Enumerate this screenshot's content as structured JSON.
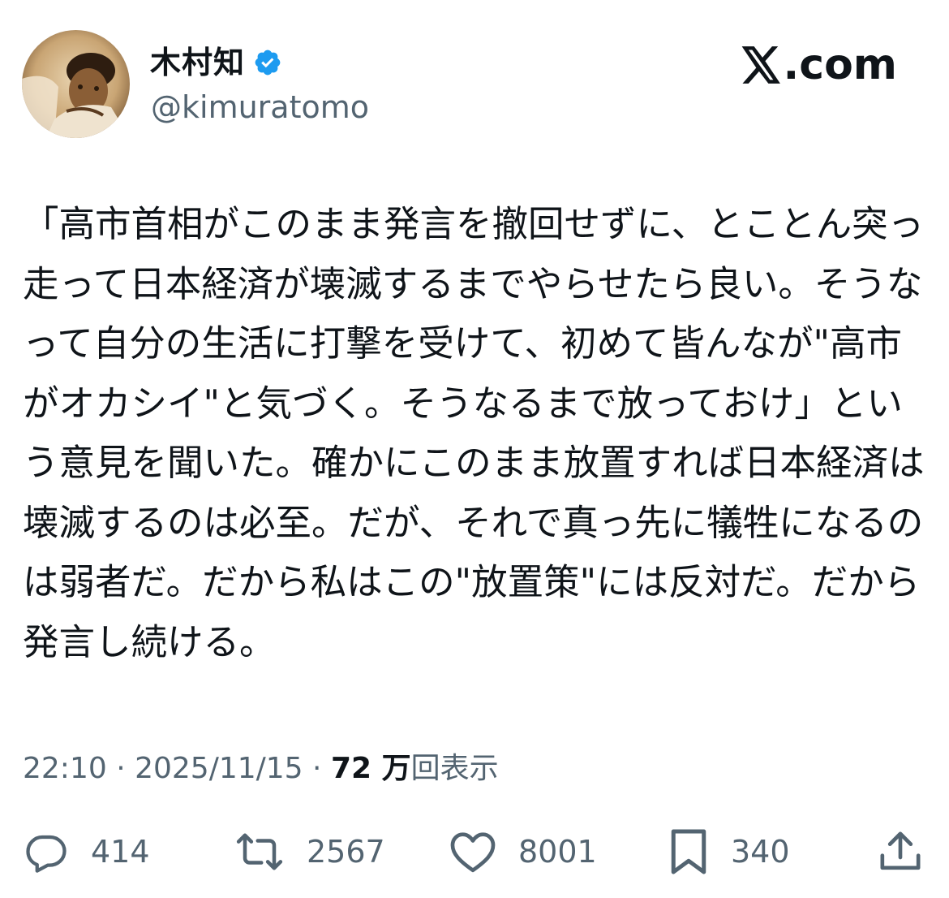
{
  "author": {
    "display_name": "木村知",
    "verified": true,
    "handle": "@kimuratomo",
    "avatar_tint": "#8a6a3f"
  },
  "brand": {
    "site": ".com",
    "logo_icon": "x-logo-icon"
  },
  "post": {
    "text": "「高市首相がこのまま発言を撤回せずに、とことん突っ走って日本経済が壊滅するまでやらせたら良い。そうなって自分の生活に打撃を受けて、初めて皆んなが\"高市がオカシイ\"と気づく。そうなるまで放っておけ」という意見を聞いた。確かにこのまま放置すれば日本経済は壊滅するのは必至。だが、それで真っ先に犠牲になるのは弱者だ。だから私はこの\"放置策\"には反対だ。だから発言し続ける。",
    "time": "22:10",
    "sep1": " · ",
    "date": "2025/11/15",
    "sep2": " · ",
    "views_count": "72 万",
    "views_label": "回表示"
  },
  "actions": {
    "reply": {
      "icon": "reply-icon",
      "count": "414"
    },
    "repost": {
      "icon": "repost-icon",
      "count": "2567"
    },
    "like": {
      "icon": "heart-icon",
      "count": "8001"
    },
    "bookmark": {
      "icon": "bookmark-icon",
      "count": "340"
    },
    "share": {
      "icon": "share-icon"
    }
  },
  "colors": {
    "text": "#0f1419",
    "secondary": "#536471",
    "verified_badge": "#1d9bf0"
  }
}
